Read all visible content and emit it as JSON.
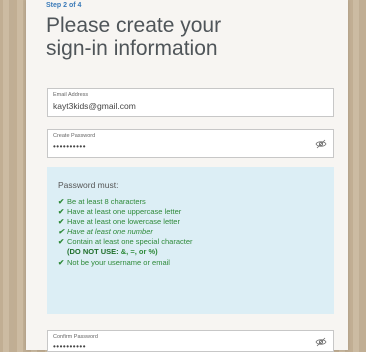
{
  "form": {
    "step_label": "Step 2 of 4",
    "title_line1": "Please create your",
    "title_line2": "sign-in information"
  },
  "fields": {
    "email": {
      "label": "Email Address",
      "value": "kayt3kids@gmail.com"
    },
    "password": {
      "label": "Create Password",
      "value": "••••••••••"
    },
    "confirm": {
      "label": "Confirm Password",
      "value": "••••••••••"
    }
  },
  "rules": {
    "title": "Password must:",
    "items": [
      "Be at least 8 characters",
      "Have at least one uppercase letter",
      "Have at least one lowercase letter",
      "Have at least one number",
      "Contain at least one special character",
      "Not be your username or email"
    ],
    "note_prefix": "(DO NOT USE:",
    "note_chars": " &, =, or %)"
  },
  "colors": {
    "accent": "#3a7ab8",
    "rules_bg": "#dceef5",
    "rule_text": "#2f8a3a",
    "title_text": "#4f5559"
  },
  "icons": {
    "password_toggle": "eye-slash-icon",
    "confirm_toggle": "eye-slash-icon",
    "rule_bullet": "checkmark-icon"
  }
}
